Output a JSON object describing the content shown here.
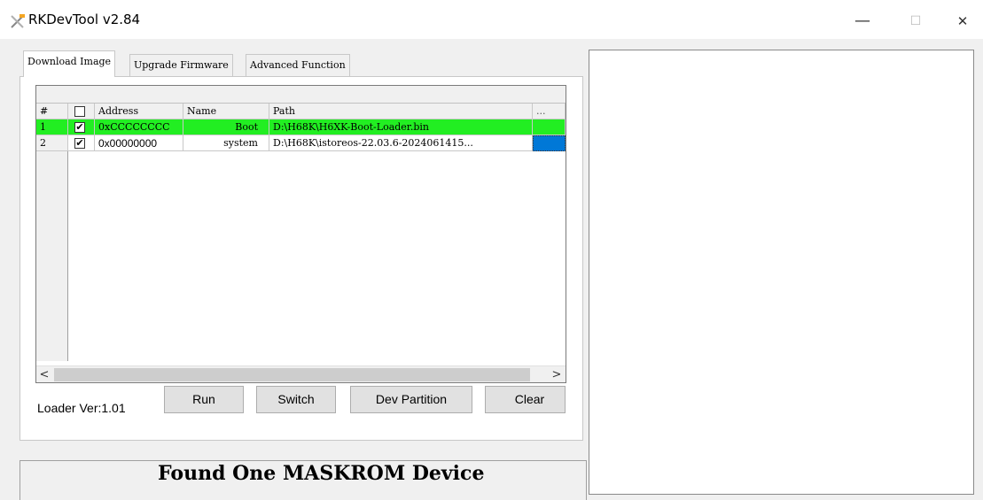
{
  "window": {
    "title": "RKDevTool v2.84",
    "minimize": "—",
    "maximize": "☐",
    "close": "✕"
  },
  "tabs": [
    {
      "label": "Download Image"
    },
    {
      "label": "Upgrade Firmware"
    },
    {
      "label": "Advanced Function"
    }
  ],
  "grid": {
    "columns": [
      "#",
      "",
      "Address",
      "Name",
      "Path",
      "..."
    ],
    "rows": [
      {
        "num": "1",
        "checked": "✔",
        "address": "0xCCCCCCCC",
        "name": "Boot",
        "path": "D:\\H68K\\H6XK-Boot-Loader.bin",
        "highlight": "#22ee22"
      },
      {
        "num": "2",
        "checked": "✔",
        "address": "0x00000000",
        "name": "system",
        "path": "D:\\H68K\\istoreos-22.03.6-2024061415...",
        "highlight": ""
      }
    ],
    "selected_cell_color": "#0078d7",
    "scroll_left": "<",
    "scroll_right": ">"
  },
  "footer": {
    "loader_version": "Loader Ver:1.01",
    "run_label": "Run",
    "switch_label": "Switch",
    "dev_partition_label": "Dev Partition",
    "clear_label": "Clear"
  },
  "status": {
    "text": "Found One MASKROM Device"
  }
}
